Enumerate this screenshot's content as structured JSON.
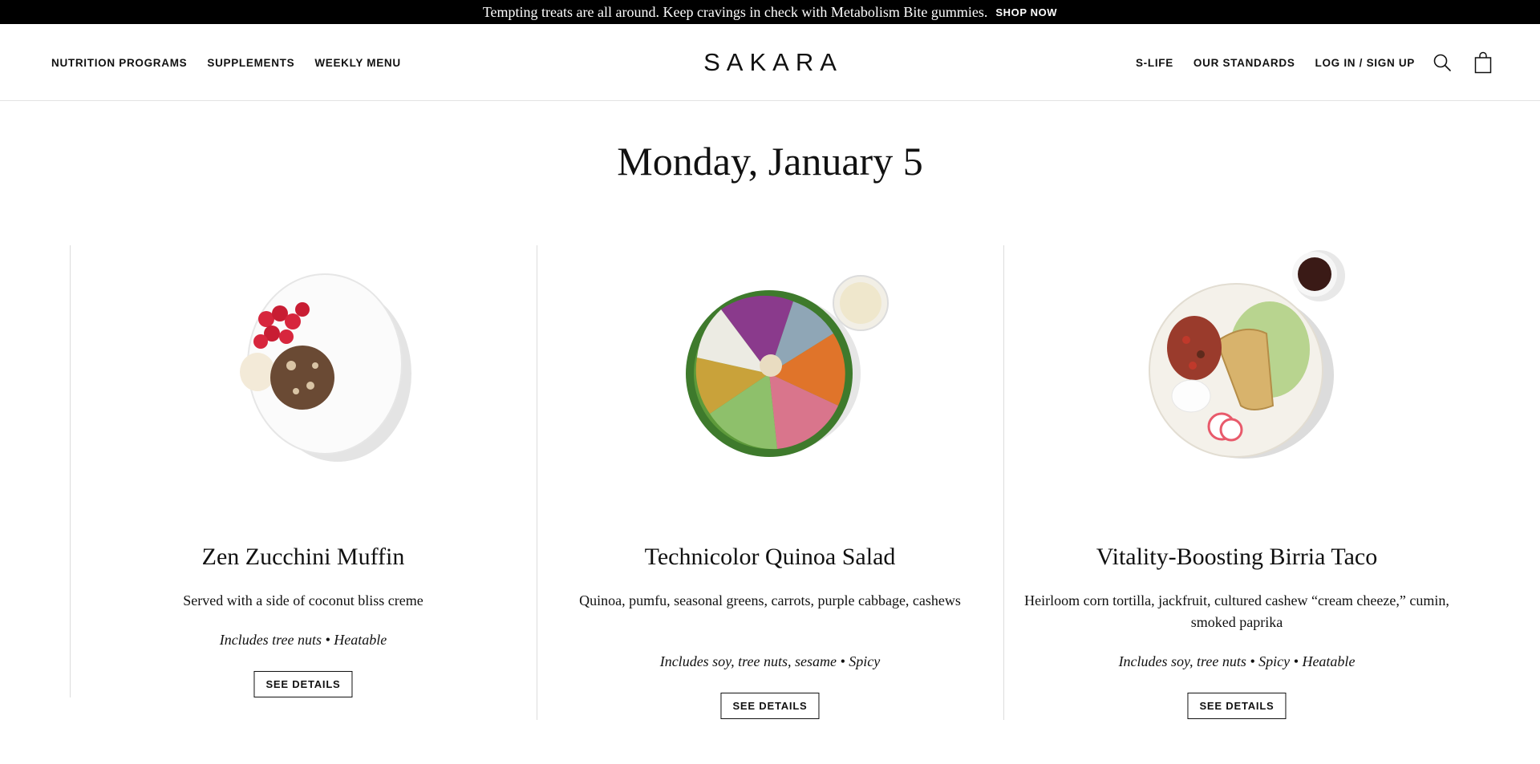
{
  "promo": {
    "text": "Tempting treats are all around. Keep cravings in check with Metabolism Bite gummies.",
    "link": "SHOP NOW"
  },
  "nav": {
    "left": [
      "NUTRITION PROGRAMS",
      "SUPPLEMENTS",
      "WEEKLY MENU"
    ],
    "right": [
      "S-LIFE",
      "OUR STANDARDS",
      "LOG IN / SIGN UP"
    ],
    "icons": [
      "search-icon",
      "bag-icon"
    ]
  },
  "logo": "SAKARA",
  "day": {
    "title": "Monday, January 5"
  },
  "dishes": [
    {
      "name": "Zen Zucchini Muffin",
      "description": "Served with a side of coconut bliss creme",
      "tags": "Includes tree nuts • Heatable",
      "button": "SEE DETAILS"
    },
    {
      "name": "Technicolor Quinoa Salad",
      "description": "Quinoa, pumfu, seasonal greens, carrots, purple cabbage, cashews",
      "tags": "Includes soy, tree nuts, sesame • Spicy",
      "button": "SEE DETAILS"
    },
    {
      "name": "Vitality-Boosting Birria Taco",
      "description": "Heirloom corn tortilla, jackfruit, cultured cashew “cream cheeze,” cumin, smoked paprika",
      "tags": "Includes soy, tree nuts • Spicy • Heatable",
      "button": "SEE DETAILS"
    }
  ],
  "colors": {
    "promo_bg": "#000000",
    "text": "#111111",
    "divider": "#dcdcdc"
  }
}
